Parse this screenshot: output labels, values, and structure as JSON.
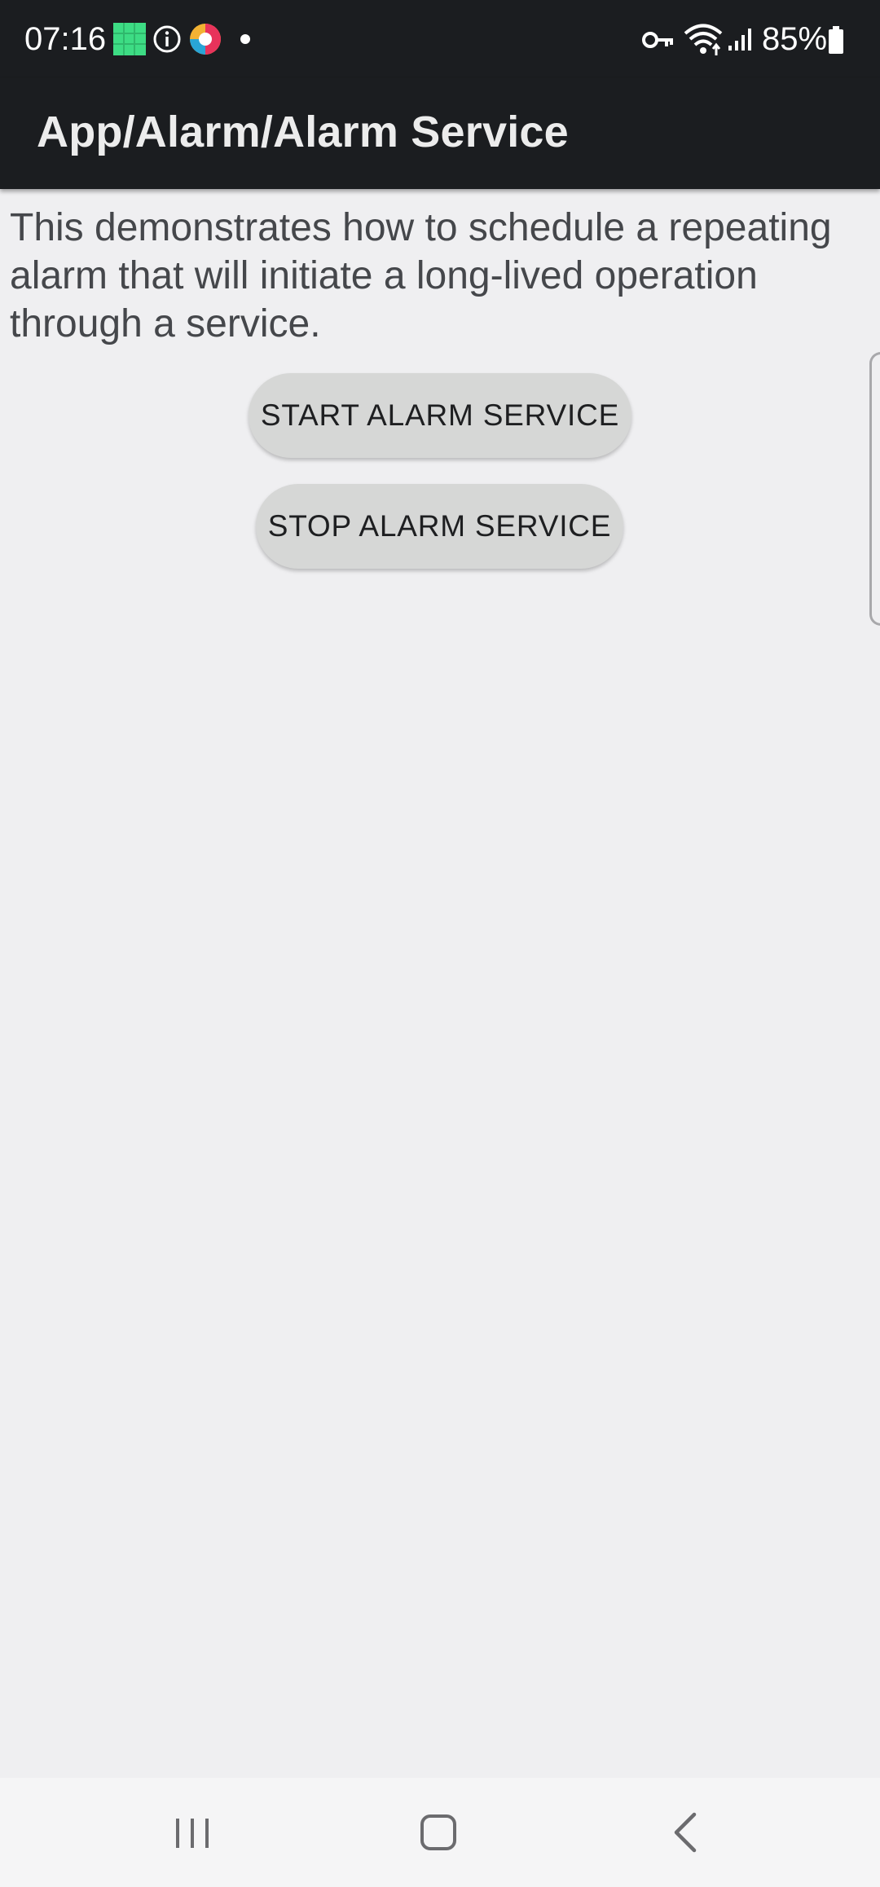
{
  "status_bar": {
    "time": "07:16",
    "battery": "85%",
    "left_icons": [
      "sheets-app-icon",
      "info-icon",
      "colorful-app-icon",
      "dot-icon"
    ],
    "right_icons": [
      "vpn-key-icon",
      "wifi-icon",
      "signal-icon",
      "battery-icon"
    ]
  },
  "app_bar": {
    "title": "App/Alarm/Alarm Service"
  },
  "content": {
    "description": "This demonstrates how to schedule a repeating alarm that will initiate a long-lived operation through a service.",
    "start_button": "START ALARM SERVICE",
    "stop_button": "STOP ALARM SERVICE"
  },
  "nav_bar": {
    "buttons": [
      "recents-icon",
      "home-icon",
      "back-icon"
    ]
  },
  "colors": {
    "app_bar_bg": "#1b1d20",
    "page_bg": "#efeff1",
    "button_bg": "#d6d7d6",
    "button_text": "#1e1f21",
    "description_text": "#45474b"
  }
}
